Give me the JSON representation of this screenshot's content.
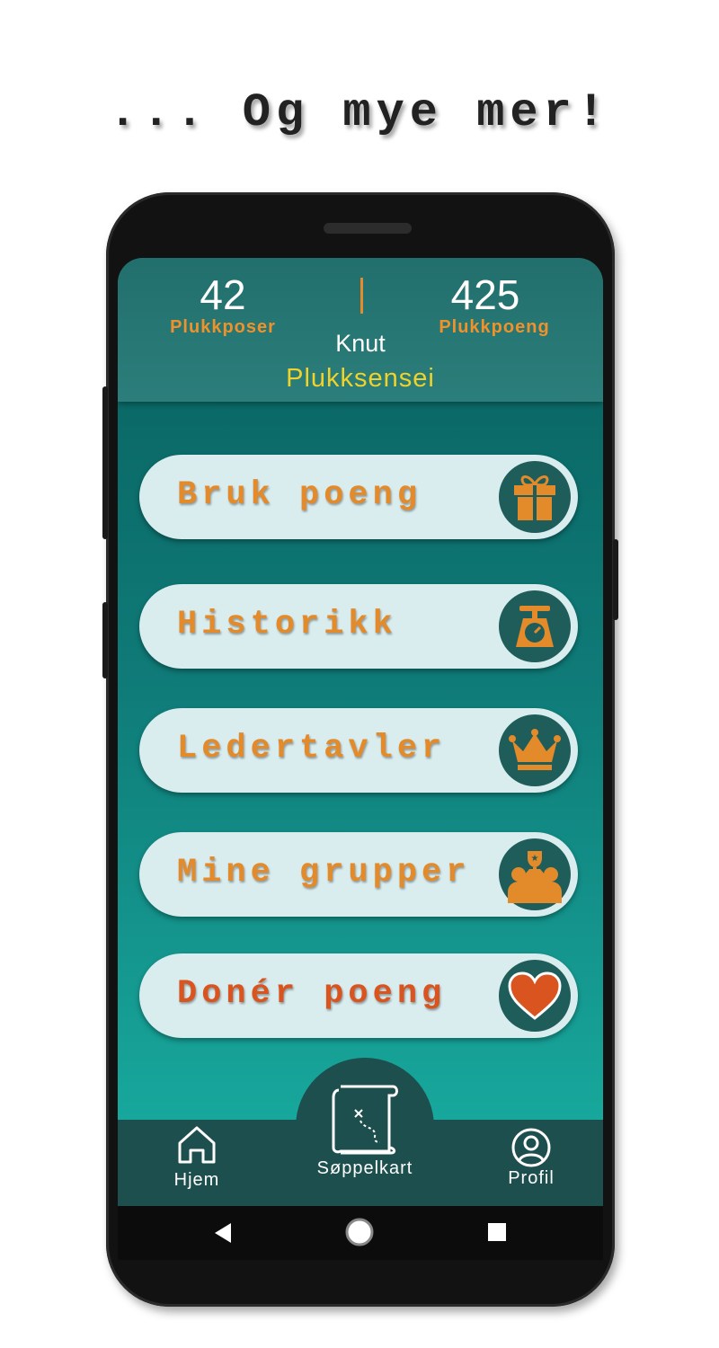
{
  "headline": "... Og mye mer!",
  "stats": {
    "bags_value": "42",
    "bags_label": "Plukkposer",
    "points_value": "425",
    "points_label": "Plukkpoeng"
  },
  "user": {
    "name": "Knut",
    "rank": "Plukksensei"
  },
  "menu": [
    {
      "label": "Bruk poeng",
      "icon": "gift-icon",
      "color": "#e38a2b"
    },
    {
      "label": "Historikk",
      "icon": "scale-icon",
      "color": "#e38a2b"
    },
    {
      "label": "Ledertavler",
      "icon": "crown-icon",
      "color": "#e38a2b"
    },
    {
      "label": "Mine grupper",
      "icon": "group-trophy-icon",
      "color": "#e38a2b"
    },
    {
      "label": "Donér poeng",
      "icon": "heart-icon",
      "color": "#d9541e"
    }
  ],
  "nav": {
    "home": "Hjem",
    "map": "Søppelkart",
    "profile": "Profil"
  },
  "colors": {
    "accent": "#e38a2b",
    "rank": "#f0d22a",
    "teal_dark": "#1d4f4e"
  }
}
